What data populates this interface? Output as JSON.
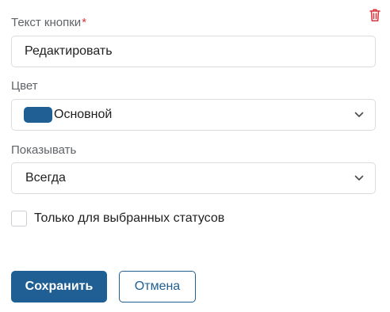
{
  "form": {
    "button_text": {
      "label": "Текст кнопки",
      "required_mark": "*",
      "value": "Редактировать"
    },
    "color": {
      "label": "Цвет",
      "value": "Основной",
      "swatch_color": "#1f5f93"
    },
    "show": {
      "label": "Показывать",
      "value": "Всегда"
    },
    "only_selected_statuses": {
      "label": "Только для выбранных статусов",
      "checked": false
    }
  },
  "icons": {
    "delete": "trash-icon",
    "dropdown": "chevron-down-icon"
  },
  "actions": {
    "save_label": "Сохранить",
    "cancel_label": "Отмена"
  },
  "colors": {
    "accent": "#1f5f93",
    "required": "#d9363e",
    "delete": "#d9363e"
  }
}
